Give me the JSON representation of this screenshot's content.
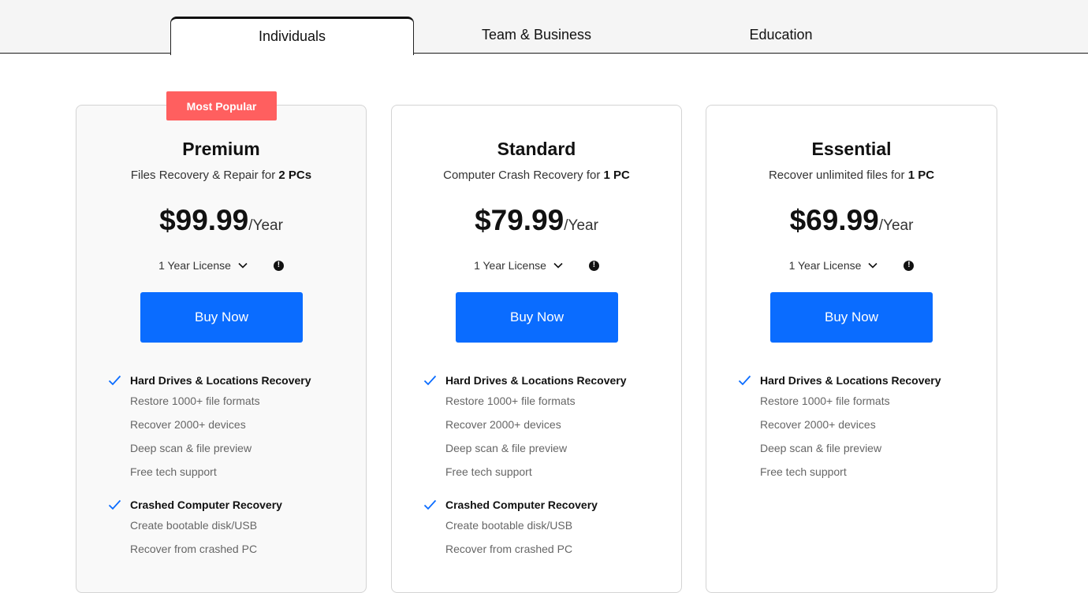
{
  "tabs": [
    {
      "label": "Individuals",
      "active": true
    },
    {
      "label": "Team & Business",
      "active": false
    },
    {
      "label": "Education",
      "active": false
    }
  ],
  "plans": [
    {
      "badge": "Most Popular",
      "name": "Premium",
      "subtitle_prefix": "Files Recovery & Repair for ",
      "subtitle_bold": "2 PCs",
      "price": "$99.99",
      "period": "/Year",
      "license": "1 Year License",
      "buy_label": "Buy Now",
      "feature_groups": [
        {
          "title": "Hard Drives & Locations Recovery",
          "items": [
            "Restore 1000+ file formats",
            "Recover 2000+ devices",
            "Deep scan & file preview",
            "Free tech support"
          ]
        },
        {
          "title": "Crashed Computer Recovery",
          "items": [
            "Create bootable disk/USB",
            "Recover from crashed PC"
          ]
        }
      ]
    },
    {
      "name": "Standard",
      "subtitle_prefix": "Computer Crash Recovery for ",
      "subtitle_bold": "1 PC",
      "price": "$79.99",
      "period": "/Year",
      "license": "1 Year License",
      "buy_label": "Buy Now",
      "feature_groups": [
        {
          "title": "Hard Drives & Locations Recovery",
          "items": [
            "Restore 1000+ file formats",
            "Recover 2000+ devices",
            "Deep scan & file preview",
            "Free tech support"
          ]
        },
        {
          "title": "Crashed Computer Recovery",
          "items": [
            "Create bootable disk/USB",
            "Recover from crashed PC"
          ]
        }
      ]
    },
    {
      "name": "Essential",
      "subtitle_prefix": "Recover unlimited files for ",
      "subtitle_bold": "1 PC",
      "price": "$69.99",
      "period": "/Year",
      "license": "1 Year License",
      "buy_label": "Buy Now",
      "feature_groups": [
        {
          "title": "Hard Drives & Locations Recovery",
          "items": [
            "Restore 1000+ file formats",
            "Recover 2000+ devices",
            "Deep scan & file preview",
            "Free tech support"
          ]
        }
      ]
    }
  ],
  "icons": {
    "check": "check-icon",
    "chevron": "chevron-down-icon",
    "info": "info-icon"
  },
  "colors": {
    "accent": "#0a6cff",
    "badge": "#ff5f5f",
    "check": "#0a6cff"
  }
}
